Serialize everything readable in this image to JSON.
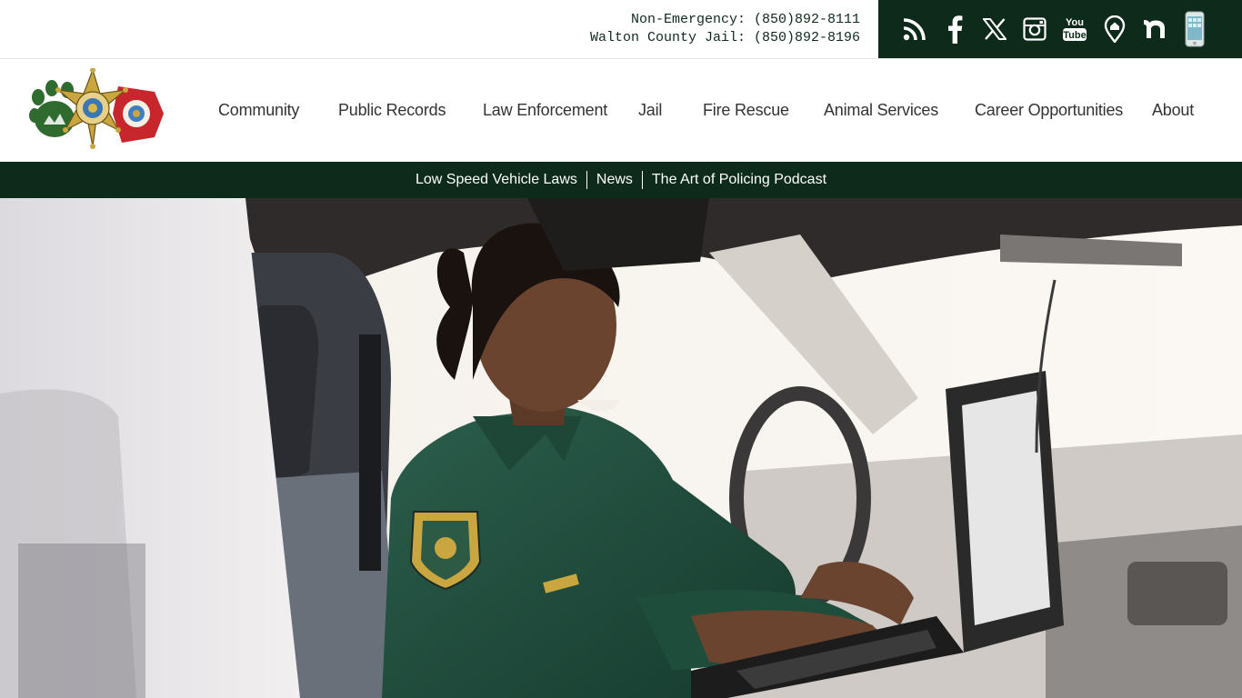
{
  "contact": {
    "non_emergency": "Non-Emergency: (850)892-8111",
    "jail": "Walton County Jail: (850)892-8196"
  },
  "social": {
    "icons": [
      "rss-icon",
      "facebook-icon",
      "x-icon",
      "instagram-icon",
      "youtube-icon",
      "location-pin-icon",
      "nextdoor-icon",
      "mobile-app-icon"
    ],
    "youtube_text_1": "You",
    "youtube_text_2": "Tube"
  },
  "nav": {
    "items": [
      {
        "label": "Community"
      },
      {
        "label": "Public Records"
      },
      {
        "label": "Law Enforcement"
      },
      {
        "label": "Jail"
      },
      {
        "label": "Fire Rescue"
      },
      {
        "label": "Animal Services"
      },
      {
        "label": "Career Opportunities"
      },
      {
        "label": "About"
      }
    ]
  },
  "subnav": {
    "items": [
      {
        "label": "Low Speed Vehicle Laws"
      },
      {
        "label": "News"
      },
      {
        "label": "The Art of Policing Podcast"
      }
    ]
  },
  "colors": {
    "brand_dark_green": "#0d2a1b",
    "nav_text": "#333333",
    "uniform_green": "#1f4d3c",
    "badge_gold": "#c9a640",
    "fire_red": "#c8262d"
  }
}
